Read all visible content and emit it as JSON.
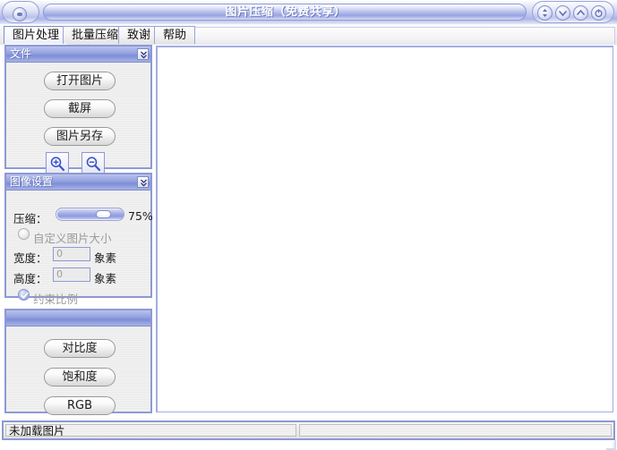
{
  "window": {
    "title": "图片压缩（免费共享）",
    "app_icon": "circle-orb-icon",
    "controls": [
      {
        "name": "restore",
        "icon": "up-down-arrows-icon"
      },
      {
        "name": "minimize",
        "icon": "chevron-down-icon"
      },
      {
        "name": "maximize",
        "icon": "chevron-up-icon"
      },
      {
        "name": "close",
        "icon": "power-icon"
      }
    ]
  },
  "tabs": [
    {
      "label": "图片处理",
      "selected": true
    },
    {
      "label": "批量压缩",
      "selected": false
    },
    {
      "label": "致谢",
      "selected": false
    },
    {
      "label": "帮助",
      "selected": false
    }
  ],
  "file_panel": {
    "title": "文件",
    "collapse_icon": "double-chevron-down-icon",
    "open_image": "打开图片",
    "screenshot": "截屏",
    "save_as": "图片另存",
    "zoom_in_icon": "magnifier-plus-icon",
    "zoom_out_icon": "magnifier-minus-icon"
  },
  "settings_panel": {
    "title": "图像设置",
    "collapse_icon": "double-chevron-down-icon",
    "compression_label": "压缩：",
    "compression_value": "75%",
    "compression_percent": 75,
    "custom_size_label": "自定义图片大小",
    "custom_size_checked": false,
    "width_label": "宽度：",
    "width_value": "0",
    "width_unit": "象素",
    "height_label": "高度：",
    "height_value": "0",
    "height_unit": "象素",
    "keep_ratio_label": "约束比例",
    "keep_ratio_checked": true
  },
  "adjust_panel": {
    "title": "",
    "contrast": "对比度",
    "saturation": "饱和度",
    "rgb": "RGB"
  },
  "statusbar": {
    "left": "未加载图片",
    "right": ""
  },
  "colors": {
    "title_bar_blue": "#98a4e2",
    "panel_header_blue": "#7d8ed6",
    "panel_border": "#8d99d4",
    "canvas_bg": "#ffffff"
  }
}
